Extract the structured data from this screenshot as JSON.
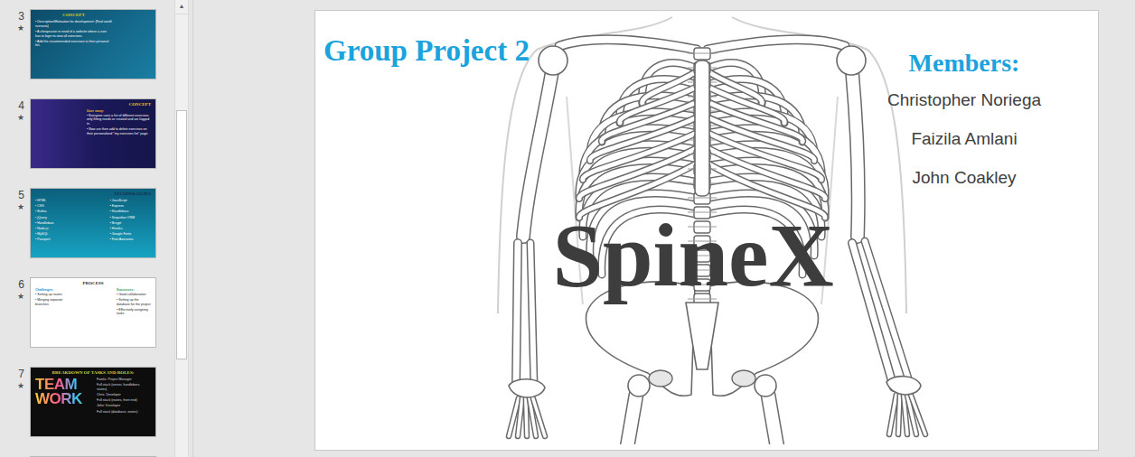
{
  "scrollbar": {
    "up_arrow": "▲"
  },
  "thumbnails": [
    {
      "number": "3",
      "star": "★",
      "selected": false,
      "kind": "concept-blue",
      "title": "CONCEPT",
      "columns": [
        {
          "items": [
            "Description/Motivation for development: (Real world scenario)",
            "A chiropractor in need of a website where a user has to login to view all exercises.",
            "Add the recommended exercises to their personal list."
          ]
        }
      ]
    },
    {
      "number": "4",
      "star": "★",
      "selected": false,
      "kind": "concept-purple",
      "title": "CONCEPT",
      "columns": [
        {
          "heading": "User story:",
          "items": [
            "Everyone uses a list of different exercises only fitting needs or created and are logged in.",
            "Now are then add to delete exercises on their personalized \"my exercises list\" page."
          ]
        }
      ]
    },
    {
      "number": "5",
      "star": "★",
      "selected": false,
      "kind": "tech",
      "title": "TECHNOLOGIES",
      "columns": [
        {
          "items": [
            "HTML",
            "CSS",
            "Bulma",
            "jQuery",
            "Handlebars",
            "Node.js",
            "MySQL",
            "Passport"
          ]
        },
        {
          "items": [
            "JavaScript",
            "Express",
            "Handlebars",
            "Sequelize ORM",
            "Bcrypt",
            "Heroku",
            "Google Fonts",
            "Font Awesome"
          ]
        }
      ]
    },
    {
      "number": "6",
      "star": "★",
      "selected": false,
      "kind": "process",
      "title": "PROCESS",
      "columns": [
        {
          "heading": "Challenges:",
          "items": [
            "Setting up routes",
            "Merging separate branches"
          ]
        },
        {
          "heading": "Successes:",
          "items": [
            "Good collaboration",
            "Setting up the database for the project",
            "Effectively assigning tasks"
          ]
        }
      ]
    },
    {
      "number": "7",
      "star": "★",
      "selected": false,
      "kind": "team",
      "title": "BREAKDOWN OF TASKS AND ROLES:",
      "art": "TEAM WORK",
      "columns": [
        {
          "items": [
            "Faizila: Project Manager",
            "Full stack (server, handlebars, routes)",
            "Chris: Developer",
            "Full stack (routes, front end)",
            "John: Developer",
            "Full stack (database, routes)"
          ]
        }
      ]
    }
  ],
  "slide": {
    "title": "Group Project 2",
    "logo": "SpineX",
    "members_label": "Members:",
    "members": [
      "Christopher Noriega",
      "Faizila Amlani",
      "John Coakley"
    ]
  }
}
